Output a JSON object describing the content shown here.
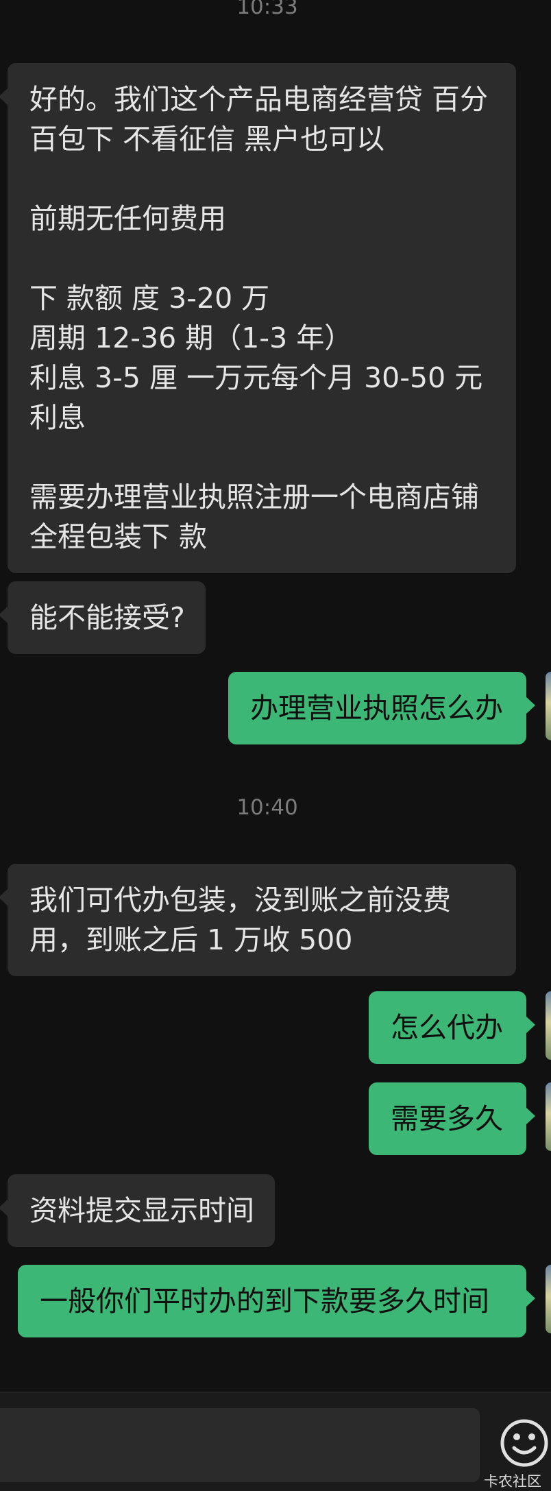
{
  "times": [
    "10:33",
    "10:40"
  ],
  "messages": [
    {
      "side": "in",
      "text": "好的。我们这个产品电商经营贷 百分百包下 不看征信 黑户也可以\n\n前期无任何费用\n\n下 款额 度 3-20 万\n周期 12-36 期（1-3 年）\n利息 3-5 厘 一万元每个月 30-50 元利息\n\n需要办理营业执照注册一个电商店铺　 全程包装下 款"
    },
    {
      "side": "in",
      "text": "能不能接受?"
    },
    {
      "side": "out",
      "text": "办理营业执照怎么办"
    },
    {
      "side": "in",
      "text": "我们可代办包装，没到账之前没费用，到账之后 1 万收 500"
    },
    {
      "side": "out",
      "text": "怎么代办"
    },
    {
      "side": "out",
      "text": "需要多久"
    },
    {
      "side": "in",
      "text": "资料提交显示时间"
    },
    {
      "side": "out",
      "text": "一般你们平时办的到下款要多久时间"
    }
  ],
  "input": {
    "placeholder": "",
    "emoji_icon": "smiley-face-icon"
  },
  "watermark": "卡农社区",
  "colors": {
    "background": "#111111",
    "incoming_bubble": "#2c2c2c",
    "outgoing_bubble": "#3cb775",
    "timestamp": "#7c7c7c"
  }
}
